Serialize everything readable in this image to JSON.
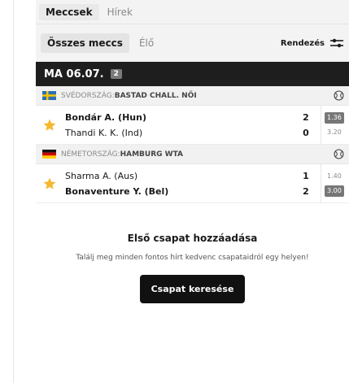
{
  "top_tabs": [
    {
      "label": "Meccsek",
      "active": true
    },
    {
      "label": "Hírek",
      "active": false
    }
  ],
  "filters": [
    {
      "label": "Összes meccs",
      "active": true
    },
    {
      "label": "Élő",
      "active": false
    }
  ],
  "sort_label": "Rendezés",
  "day": {
    "label": "MA 06.07.",
    "count": "2"
  },
  "leagues": [
    {
      "country": "SVÉDORSZÁG: ",
      "name": "BASTAD CHALL. NŐI",
      "flag": "sweden",
      "match": {
        "home": {
          "name": "Bondár A. (Hun)",
          "score": "2",
          "odd": "1.36",
          "winner": true
        },
        "away": {
          "name": "Thandi K. K. (Ind)",
          "score": "0",
          "odd": "3.20",
          "winner": false
        }
      }
    },
    {
      "country": "NÉMETORSZÁG: ",
      "name": "HAMBURG WTA",
      "flag": "germany",
      "match": {
        "home": {
          "name": "Sharma A. (Aus)",
          "score": "1",
          "odd": "1.40",
          "winner": false
        },
        "away": {
          "name": "Bonaventure Y. (Bel)",
          "score": "2",
          "odd": "3.00",
          "winner": true
        }
      }
    }
  ],
  "empty_state": {
    "title": "Első csapat hozzáadása",
    "description": "Találj meg minden fontos hírt kedvenc csapataidról egy helyen!",
    "button": "Csapat keresése"
  },
  "colors": {
    "star": "#f5b82e",
    "dark": "#1e1e1e",
    "odd_highlight": "#777777"
  },
  "icons": [
    "sort-icon",
    "tennis-ball-icon",
    "star-icon",
    "sweden-flag-icon",
    "germany-flag-icon"
  ]
}
